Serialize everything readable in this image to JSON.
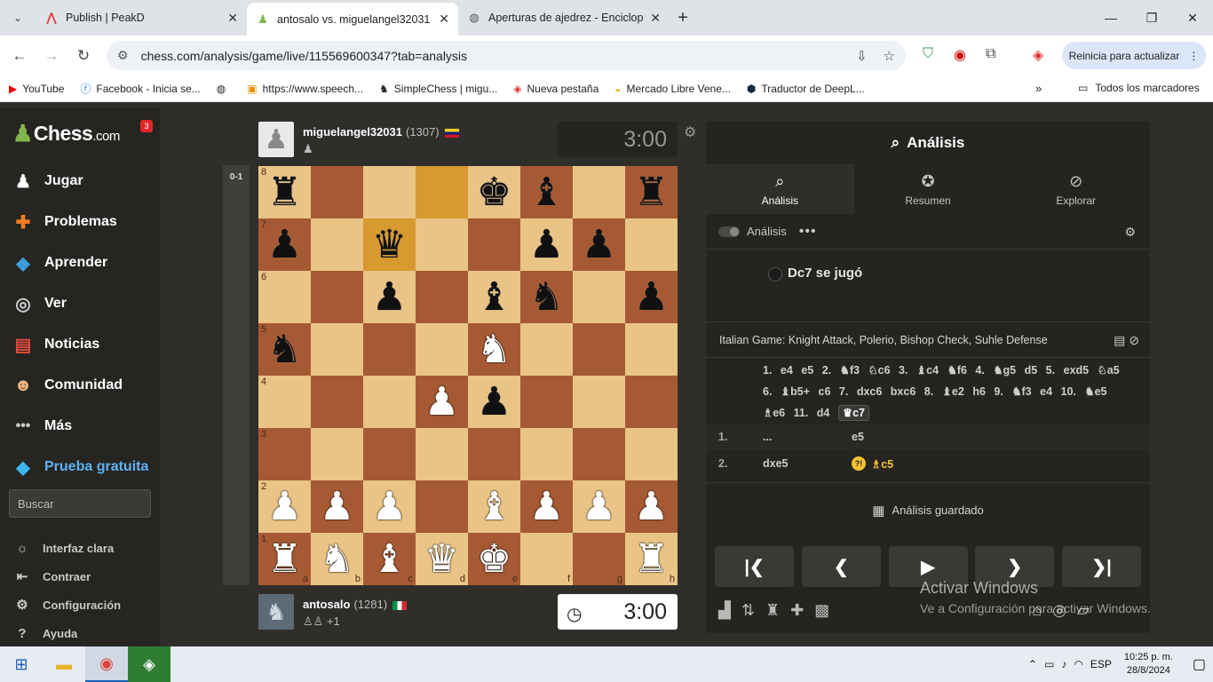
{
  "browser": {
    "tabs": [
      {
        "title": "Publish | PeakD",
        "icon": "peakd-icon",
        "active": false
      },
      {
        "title": "antosalo vs. miguelangel32031",
        "icon": "chess-pawn-icon",
        "active": true
      },
      {
        "title": "Aperturas de ajedrez - Enciclop",
        "icon": "globe-icon",
        "active": false
      }
    ],
    "url": "chess.com/analysis/game/live/115569600347?tab=analysis",
    "update_label": "Reinicia para actualizar",
    "bookmarks": [
      "YouTube",
      "Facebook - Inicia se...",
      "",
      "https://www.speech...",
      "SimpleChess | migu...",
      "Nueva pestaña",
      "Mercado Libre Vene...",
      "Traductor de DeepL..."
    ],
    "all_bookmarks": "Todos los marcadores"
  },
  "sidebar": {
    "logo_main": "Chess",
    "logo_suffix": ".com",
    "badge": "3",
    "items": [
      {
        "label": "Jugar",
        "icon": "play-icon"
      },
      {
        "label": "Problemas",
        "icon": "puzzle-icon"
      },
      {
        "label": "Aprender",
        "icon": "learn-icon"
      },
      {
        "label": "Ver",
        "icon": "watch-icon"
      },
      {
        "label": "Noticias",
        "icon": "news-icon"
      },
      {
        "label": "Comunidad",
        "icon": "community-icon"
      },
      {
        "label": "Más",
        "icon": "more-icon"
      },
      {
        "label": "Prueba gratuita",
        "icon": "diamond-icon"
      }
    ],
    "search_placeholder": "Buscar",
    "sub_items": [
      {
        "label": "Interfaz clara",
        "icon": "sun-icon"
      },
      {
        "label": "Contraer",
        "icon": "collapse-icon"
      },
      {
        "label": "Configuración",
        "icon": "gear-icon"
      },
      {
        "label": "Ayuda",
        "icon": "help-icon"
      }
    ]
  },
  "game": {
    "eval": "0-1",
    "top_player": {
      "name": "miguelangel32031",
      "rating": "(1307)",
      "clock": "3:00",
      "flag": "Venezuela"
    },
    "bottom_player": {
      "name": "antosalo",
      "rating": "(1281)",
      "clock": "3:00",
      "flag": "Italy",
      "extra": "+1"
    },
    "board_rows": [
      [
        "r",
        "",
        "",
        "",
        "k",
        "b",
        "",
        "r"
      ],
      [
        "p",
        "",
        "q",
        "",
        "",
        "p",
        "p",
        ""
      ],
      [
        "",
        "",
        "p",
        "",
        "b",
        "n",
        "",
        "p"
      ],
      [
        "n",
        "",
        "",
        "",
        "N",
        "",
        "",
        ""
      ],
      [
        "",
        "",
        "",
        "P",
        "p",
        "",
        "",
        ""
      ],
      [
        "",
        "",
        "",
        "",
        "",
        "",
        "",
        ""
      ],
      [
        "P",
        "P",
        "P",
        "",
        "B",
        "P",
        "P",
        "P"
      ],
      [
        "R",
        "N",
        "B",
        "Q",
        "K",
        "",
        "",
        "R"
      ]
    ],
    "highlight_squares": [
      [
        0,
        3
      ],
      [
        1,
        2
      ]
    ],
    "ranks": [
      "8",
      "7",
      "6",
      "5",
      "4",
      "3",
      "2",
      "1"
    ],
    "files": [
      "a",
      "b",
      "c",
      "d",
      "e",
      "f",
      "g",
      "h"
    ]
  },
  "analysis": {
    "title": "Análisis",
    "tabs": [
      {
        "label": "Análisis",
        "icon": "analysis-icon"
      },
      {
        "label": "Resumen",
        "icon": "star-icon"
      },
      {
        "label": "Explorar",
        "icon": "compass-icon"
      }
    ],
    "toggle_label": "Análisis",
    "played_text": "Dc7 se jugó",
    "opening": "Italian Game: Knight Attack, Polerio, Bishop Check, Suhle Defense",
    "pgn_moves": [
      "1.",
      "e4",
      "e5",
      "2.",
      "♞f3",
      "♘c6",
      "3.",
      "♝c4",
      "♞f6",
      "4.",
      "♞g5",
      "d5",
      "5.",
      "exd5",
      "♘a5",
      "6.",
      "♝b5+",
      "c6",
      "7.",
      "dxc6",
      "bxc6",
      "8.",
      "♝e2",
      "h6",
      "9.",
      "♞f3",
      "e4",
      "10.",
      "♞e5",
      "♗e6",
      "11.",
      "d4",
      "♛c7"
    ],
    "rows": [
      {
        "num": "1.",
        "white": "...",
        "black": "e5",
        "inaccuracy": false
      },
      {
        "num": "2.",
        "white": "dxe5",
        "black": "♗c5",
        "inaccuracy": true,
        "inaccuracy_label": "?!"
      }
    ],
    "saved_label": "Análisis guardado"
  },
  "windows": {
    "watermark_title": "Activar Windows",
    "watermark_sub": "Ve a Configuración para activar Windows.",
    "lang": "ESP",
    "time": "10:25 p. m.",
    "date": "28/8/2024"
  }
}
